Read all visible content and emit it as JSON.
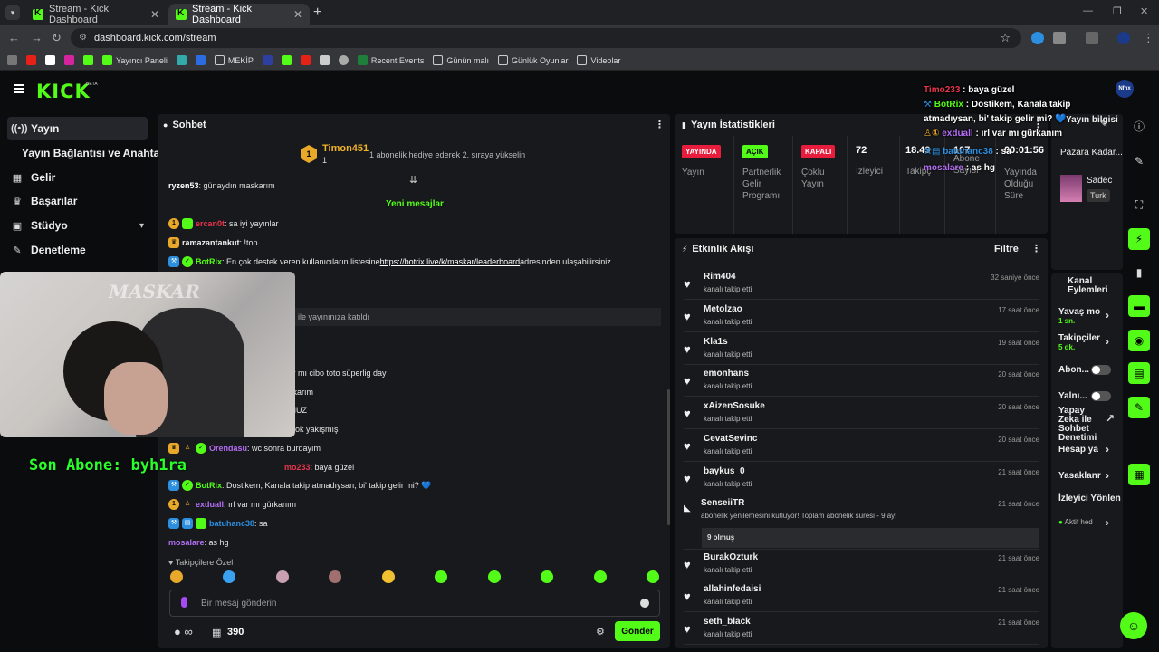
{
  "browser": {
    "tabs": [
      {
        "title": "Stream - Kick Dashboard",
        "active": false
      },
      {
        "title": "Stream - Kick Dashboard",
        "active": true
      }
    ],
    "url": "dashboard.kick.com/stream",
    "bookmarks": [
      "Yayıncı Paneli",
      "MEKİP",
      "Recent Events",
      "Günün malı",
      "Günlük Oyunlar",
      "Videolar"
    ]
  },
  "header": {
    "logo": "KICK",
    "beta": "BETA",
    "avatar_label": "Nfnx"
  },
  "sidebar": {
    "items": [
      {
        "label": "Yayın",
        "icon": "broadcast-icon"
      },
      {
        "label": "Gelir",
        "icon": "money-icon"
      },
      {
        "label": "Başarılar",
        "icon": "trophy-icon"
      },
      {
        "label": "Stüdyo",
        "icon": "studio-icon"
      },
      {
        "label": "Denetleme",
        "icon": "wrench-icon"
      }
    ],
    "sub_label": "Yayın Bağlantısı ve Anahtarı"
  },
  "webcam": {
    "watermark": "MASKAR",
    "last_sub": "Son Abone: byh1ra"
  },
  "chat": {
    "title": "Sohbet",
    "sub_banner": {
      "name": "Timon451",
      "count": "1",
      "message": "1 abonelik hediye ederek 2. sıraya yükselin"
    },
    "cut_line": {
      "user": "ryzen53",
      "text": ": günaydın maskarım"
    },
    "new_messages": "Yeni mesajlar",
    "messages": [
      {
        "user": "ercan0t",
        "color": "#e8344d",
        "text": ": sa iyi yayınlar"
      },
      {
        "user": "ramazantankut",
        "color": "#f0f0f0",
        "text": ": !top"
      },
      {
        "user": "BotRix",
        "color": "#53fc18",
        "text": ": En çok destek veren kullanıcıların listesine ",
        "link": "https://botrix.live/k/maskar/leaderboard",
        "after": " adresinden ulaşabilirsiniz."
      },
      {
        "text": "ci ile yayınınıza katıldı"
      },
      {
        "text": "çar mı cibo toto süperlig day"
      },
      {
        "text": "askarım"
      },
      {
        "text": "UNUZ"
      },
      {
        "text": "a çok yakışmış"
      },
      {
        "user": "Orendasu",
        "color": "#b46ef5",
        "text": ": wc sonra burdayım"
      },
      {
        "user": "mo233",
        "color": "#e8344d",
        "text": ": baya güzel"
      },
      {
        "user": "BotRix",
        "color": "#53fc18",
        "text": ": Dostikem, Kanala takip atmadıysan, bi' takip gelir mi? 💙"
      },
      {
        "user": "exduall",
        "color": "#b46ef5",
        "text": ": ırl var mı gürkanım"
      },
      {
        "user": "batuhanc38",
        "color": "#2d8fe0",
        "text": ": sa"
      },
      {
        "user": "mosalare",
        "color": "#b46ef5",
        "text": ": as hg"
      }
    ],
    "followers_only": "Takipçilere Özel",
    "input_placeholder": "Bir mesaj gönderin",
    "infinity": "∞",
    "points": "390",
    "send": "Gönder"
  },
  "stats": {
    "title": "Yayın İstatistikleri",
    "live_badge": "YAYINDA",
    "live_label": "Yayın",
    "partner_badge": "AÇIK",
    "partner_label": "Partnerlik Gelir Programı",
    "multi_badge": "KAPALI",
    "multi_label": "Çoklu Yayın",
    "viewers": "72",
    "viewers_label": "İzleyici",
    "followers": "18.49",
    "followers_label": "Takipç",
    "subs": "107",
    "subs_label": "Abone Sayısı",
    "uptime": "00:01:56",
    "uptime_label": "Yayında Olduğu Süre"
  },
  "activity": {
    "title": "Etkinlik Akışı",
    "filter": "Filtre",
    "events": [
      {
        "name": "Rim404",
        "sub": "kanalı takip etti",
        "time": "32 saniye önce"
      },
      {
        "name": "Metolzao",
        "sub": "kanalı takip etti",
        "time": "17 saat önce"
      },
      {
        "name": "Kla1s",
        "sub": "kanalı takip etti",
        "time": "19 saat önce"
      },
      {
        "name": "emonhans",
        "sub": "kanalı takip etti",
        "time": "20 saat önce"
      },
      {
        "name": "xAizenSosuke",
        "sub": "kanalı takip etti",
        "time": "20 saat önce"
      },
      {
        "name": "CevatSevinc",
        "sub": "kanalı takip etti",
        "time": "20 saat önce"
      },
      {
        "name": "baykus_0",
        "sub": "kanalı takip etti",
        "time": "21 saat önce"
      },
      {
        "name": "SenseiiTR",
        "sub": "abonelik yenilemesini kutluyor! Toplam abonelik süresi - 9 ay!",
        "time": "21 saat önce",
        "note": "9 olmuş"
      },
      {
        "name": "BurakOzturk",
        "sub": "kanalı takip etti",
        "time": "21 saat önce"
      },
      {
        "name": "allahinfedaisi",
        "sub": "kanalı takip etti",
        "time": "21 saat önce"
      },
      {
        "name": "seth_black",
        "sub": "kanalı takip etti",
        "time": "21 saat önce"
      }
    ]
  },
  "stream_info": {
    "title": "Yayın bilgisi",
    "stream_name": "Pazara Kadar...",
    "category": "Sadec",
    "tag": "Turk"
  },
  "channel_actions": {
    "title": "Kanal Eylemleri",
    "slow_mode": "Yavaş mo",
    "slow_mode_value": "1 sn.",
    "followers": "Takipçiler",
    "followers_value": "5 dk.",
    "subs": "Abon...",
    "emotes": "Yalnı...",
    "ai_mod": "Yapay Zeka ile Sohbet Denetimi",
    "account_age": "Hesap ya",
    "banned": "Yasaklanr",
    "viewer_dir": "İzleyici Yönlen",
    "active": "Aktif hed"
  },
  "overlay": [
    {
      "user": "Timo233",
      "color": "#e8344d",
      "text": " : baya güzel"
    },
    {
      "user": "BotRix",
      "color": "#53fc18",
      "text": " : Dostikem, Kanala takip atmadıysan, bi' takip gelir mi? 💙"
    },
    {
      "user": "exduall",
      "color": "#b46ef5",
      "text": " : ırl var mı gürkanım"
    },
    {
      "user": "batuhanc38",
      "color": "#2d8fe0",
      "text": " : sa"
    },
    {
      "user": "mosalare",
      "color": "#b46ef5",
      "text": " : as hg"
    }
  ],
  "colors": {
    "accent": "#53fc18",
    "panel": "#18191c",
    "bg": "#0b0c0e"
  }
}
